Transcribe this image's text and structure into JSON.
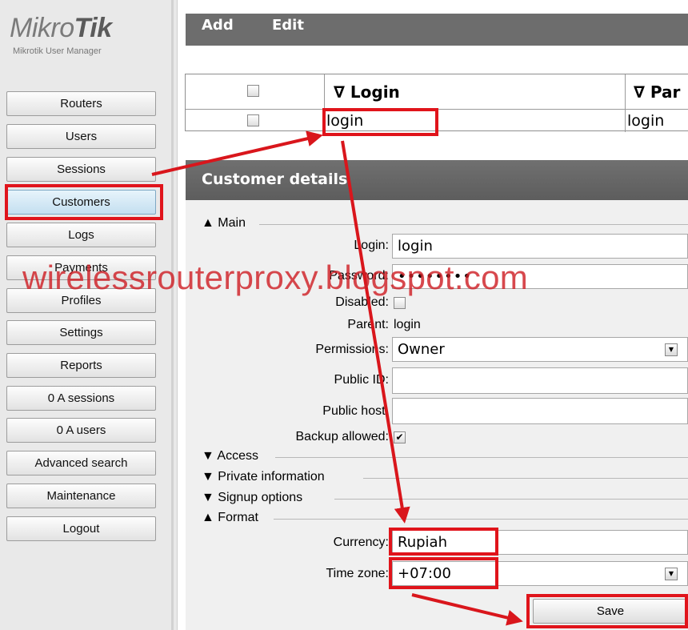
{
  "logo": {
    "brand_light": "Mikro",
    "brand_bold": "Tik",
    "subtitle": "Mikrotik User Manager"
  },
  "sidebar": {
    "items": [
      {
        "label": "Routers"
      },
      {
        "label": "Users"
      },
      {
        "label": "Sessions"
      },
      {
        "label": "Customers",
        "active": true
      },
      {
        "label": "Logs"
      },
      {
        "label": "Payments"
      },
      {
        "label": "Profiles"
      },
      {
        "label": "Settings"
      },
      {
        "label": "Reports"
      },
      {
        "label": "0 A sessions"
      },
      {
        "label": "0 A users"
      },
      {
        "label": "Advanced search"
      },
      {
        "label": "Maintenance"
      },
      {
        "label": "Logout"
      }
    ]
  },
  "toolbar": {
    "add_label": "Add",
    "edit_label": "Edit"
  },
  "grid": {
    "columns": [
      "∇ Login",
      "∇ Par"
    ],
    "rows": [
      {
        "login": "login",
        "parent": "login"
      }
    ]
  },
  "panel": {
    "title": "Customer details",
    "sections": {
      "main": "Main",
      "access": "Access",
      "private": "Private information",
      "signup": "Signup options",
      "format": "Format"
    },
    "labels": {
      "login": "Login:",
      "password": "Password:",
      "disabled": "Disabled:",
      "parent": "Parent:",
      "permissions": "Permissions:",
      "public_id": "Public ID:",
      "public_host": "Public host:",
      "backup": "Backup allowed:",
      "currency": "Currency:",
      "timezone": "Time zone:"
    },
    "values": {
      "login": "login",
      "password": "••••••••",
      "parent": "login",
      "permissions": "Owner",
      "public_id": "",
      "public_host": "",
      "disabled": false,
      "backup_allowed": true,
      "currency": "Rupiah",
      "timezone": "+07:00"
    },
    "save_label": "Save"
  },
  "watermark": "wirelessrouterproxy.blogspot.com",
  "colors": {
    "highlight": "#e0141b",
    "toolbar": "#6d6d6d",
    "panel_header": "#666666"
  }
}
